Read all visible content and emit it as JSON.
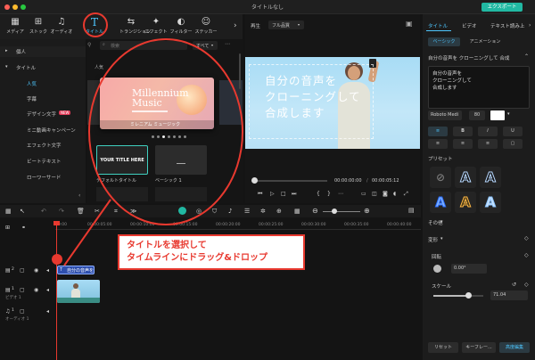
{
  "window": {
    "title": "タイトルなし",
    "export_label": "エクスポート"
  },
  "toolbar": {
    "items": [
      {
        "label": "メディア"
      },
      {
        "label": "ストック"
      },
      {
        "label": "オーディオ"
      },
      {
        "label": "タイトル"
      },
      {
        "label": "トランジション"
      },
      {
        "label": "エフェクト"
      },
      {
        "label": "フィルター"
      },
      {
        "label": "ステッカー"
      }
    ]
  },
  "leftnav": {
    "items": [
      "個人",
      "タイトル",
      "人気",
      "字幕",
      "デザイン文字",
      "ミニ動画キャンペーン",
      "エフェクト文字",
      "ビートテキスト",
      "ローワーサード"
    ],
    "new_badge": "NEW"
  },
  "grid": {
    "search_placeholder": "検索",
    "filter_label": "すべて",
    "section_label": "人気",
    "featured_title": "Millennium Music",
    "featured_caption": "ミレニアム ミュージック",
    "default_title_text": "YOUR TITLE HERE",
    "default_title_label": "デフォルトタイトル",
    "basic_label": "ベーシック 1"
  },
  "viewer": {
    "play_label": "再生",
    "quality_label": "フル品質",
    "overlay_text": [
      "自分の音声を",
      "クローニングして",
      "合成します"
    ],
    "time_current": "00:00:00:00",
    "time_total": "00:00:05:12",
    "time_sep": "/"
  },
  "right_panel": {
    "tabs": [
      "タイトル",
      "ビデオ",
      "テキスト読み上"
    ],
    "subtabs": [
      "ベーシック",
      "アニメーション"
    ],
    "text_value": "自分の音声を クローニングして 合成",
    "textarea_lines": [
      "自分の音声を",
      "クローニングして",
      "合成します"
    ],
    "font_name": "Roboto Medi",
    "font_size": "80",
    "preset_label": "プリセット",
    "other_label": "その他",
    "transform_label": "変形",
    "rotate_label": "回転",
    "rotate_value": "0.00°",
    "scale_label": "スケール",
    "scale_value": "71.04",
    "scale_fraction": 0.71,
    "reset_label": "リセット",
    "keyframe_label": "キーフレー...",
    "advanced_label": "高度編集"
  },
  "timeline": {
    "ruler": [
      "00:00",
      "00:00:05:00",
      "00:00:10:00",
      "00:00:15:00",
      "00:00:20:00",
      "00:00:25:00",
      "00:00:30:00",
      "00:00:35:00",
      "00:00:40:00"
    ],
    "title_clip_label": "自分の音声を",
    "video_track_label": "ビデオ 1",
    "audio_track_label": "オーディオ 1",
    "track_numbers": [
      "2",
      "1",
      "1"
    ]
  },
  "annotation": {
    "line1": "タイトルを選択して",
    "line2": "タイムラインにドラッグ&ドロップ"
  },
  "colors": {
    "accent": "#21b8a2",
    "annotation_red": "#e8392f",
    "highlight_blue": "#4a7cff",
    "video_blue": "#8ec9f5"
  }
}
